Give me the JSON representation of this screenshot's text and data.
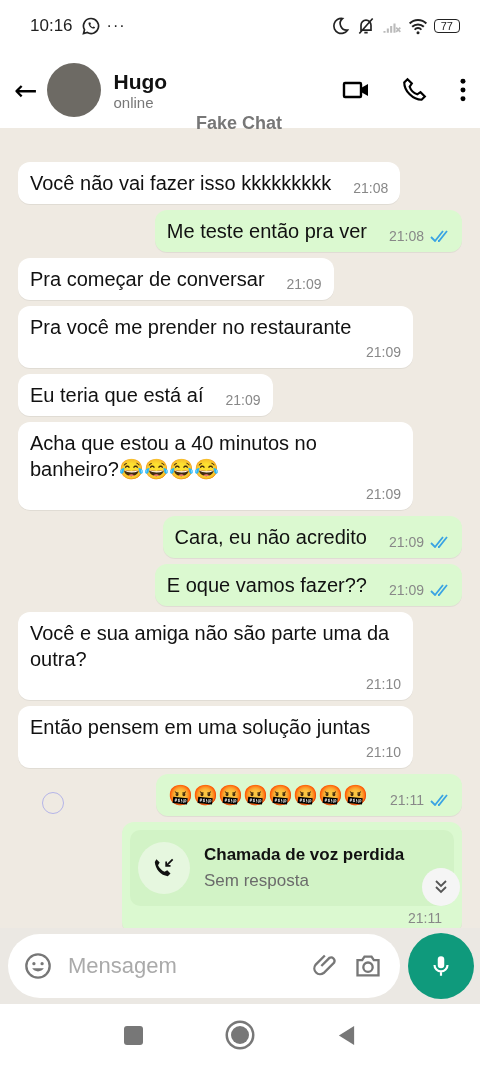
{
  "status_bar": {
    "time": "10:16",
    "more": "···",
    "battery": "77"
  },
  "header": {
    "back": "←",
    "name": "Hugo",
    "status": "online",
    "overlay": "Fake Chat"
  },
  "messages": [
    {
      "kind": "text",
      "outgoing": false,
      "text": "Você não vai fazer isso kkkkkkkkk",
      "time": "21:08"
    },
    {
      "kind": "text",
      "outgoing": true,
      "read": true,
      "text": "Me teste então pra ver",
      "time": "21:08"
    },
    {
      "kind": "text",
      "outgoing": false,
      "text": "Pra começar de conversar",
      "time": "21:09"
    },
    {
      "kind": "text",
      "outgoing": false,
      "text": "Pra você me prender no restaurante",
      "time": "21:09"
    },
    {
      "kind": "text",
      "outgoing": false,
      "text": "Eu teria que está aí",
      "time": "21:09"
    },
    {
      "kind": "text",
      "outgoing": false,
      "text": "Acha que estou a 40 minutos no banheiro?😂😂😂😂",
      "time": "21:09"
    },
    {
      "kind": "text",
      "outgoing": true,
      "read": true,
      "text": "Cara, eu não acredito",
      "time": "21:09"
    },
    {
      "kind": "text",
      "outgoing": true,
      "read": true,
      "text": "E oque vamos fazer??",
      "time": "21:09"
    },
    {
      "kind": "text",
      "outgoing": false,
      "text": "Você e sua amiga não são parte uma da outra?",
      "time": "21:10"
    },
    {
      "kind": "text",
      "outgoing": false,
      "text": "Então pensem em uma solução juntas",
      "time": "21:10"
    },
    {
      "kind": "text",
      "outgoing": true,
      "read": true,
      "marker": true,
      "text": "🤬🤬🤬🤬🤬🤬🤬🤬",
      "time": "21:11"
    },
    {
      "kind": "call",
      "outgoing": true,
      "title": "Chamada de voz perdida",
      "subtitle": "Sem resposta",
      "time": "21:11"
    }
  ],
  "composer": {
    "placeholder": "Mensagem"
  }
}
